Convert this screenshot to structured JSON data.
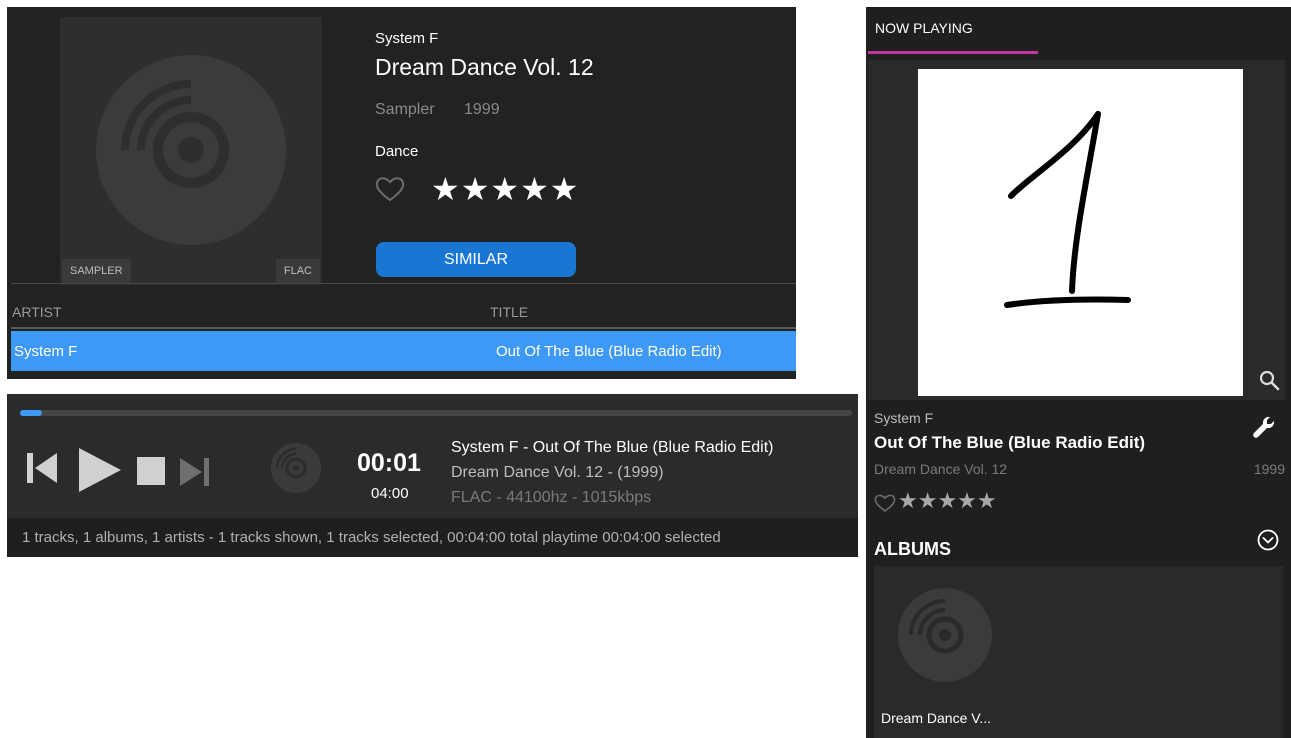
{
  "album": {
    "artist": "System F",
    "title": "Dream Dance Vol. 12",
    "type": "Sampler",
    "year": "1999",
    "genre": "Dance",
    "rating": 5,
    "stars": "★★★★★",
    "tags": [
      "SAMPLER",
      "FLAC"
    ],
    "similar_label": "SIMILAR"
  },
  "track_list": {
    "columns": [
      "ARTIST",
      "TITLE"
    ],
    "rows": [
      {
        "artist": "System F",
        "title": "Out Of The Blue (Blue Radio Edit)",
        "selected": true
      }
    ]
  },
  "player": {
    "progress_fraction": 0.004,
    "elapsed": "00:01",
    "total": "04:00",
    "now_playing_line1": "System F - Out Of The Blue (Blue Radio Edit)",
    "now_playing_line2": "Dream Dance Vol. 12 - (1999)",
    "now_playing_line3": "FLAC - 44100hz - 1015kbps",
    "status": "1 tracks, 1 albums, 1 artists - 1 tracks shown, 1 tracks selected, 00:04:00 total playtime 00:04:00 selected"
  },
  "now_playing_panel": {
    "tab_label": "NOW PLAYING",
    "artist": "System F",
    "title": "Out Of The Blue (Blue Radio Edit)",
    "album": "Dream Dance Vol. 12",
    "year": "1999",
    "stars": "★★★★★",
    "albums_heading": "ALBUMS",
    "album_card_label": "Dream Dance V..."
  },
  "colors": {
    "accent_blue": "#3d99f5",
    "button_blue": "#1976d2",
    "tab_underline": "#c2379e"
  },
  "icons": [
    "heart-outline-icon",
    "star-icon",
    "previous-icon",
    "play-icon",
    "stop-icon",
    "next-icon",
    "disc-icon",
    "search-icon",
    "wrench-icon",
    "chevron-down-circle-icon"
  ]
}
